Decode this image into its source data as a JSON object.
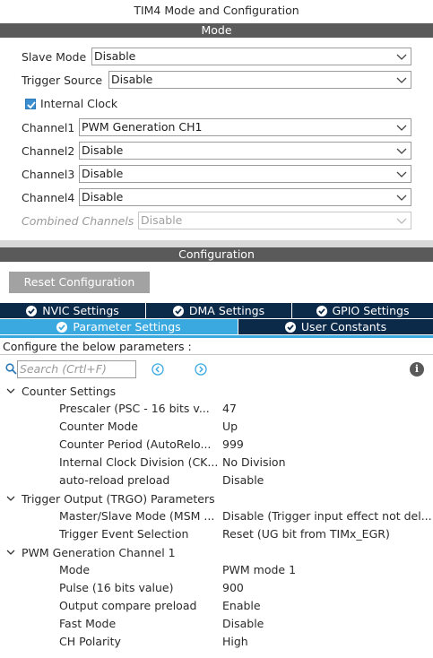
{
  "window_title": "TIM4 Mode and Configuration",
  "mode_section": {
    "title": "Mode",
    "slave_mode": {
      "label": "Slave Mode",
      "value": "Disable"
    },
    "trigger_source": {
      "label": "Trigger Source",
      "value": "Disable"
    },
    "internal_clock": {
      "label": "Internal Clock",
      "checked": true
    },
    "channel1": {
      "label": "Channel1",
      "value": "PWM Generation CH1"
    },
    "channel2": {
      "label": "Channel2",
      "value": "Disable"
    },
    "channel3": {
      "label": "Channel3",
      "value": "Disable"
    },
    "channel4": {
      "label": "Channel4",
      "value": "Disable"
    },
    "combined_channels": {
      "label": "Combined Channels",
      "value": "Disable",
      "enabled": false
    }
  },
  "configuration_section": {
    "title": "Configuration",
    "reset_button": "Reset Configuration",
    "tabs_row1": [
      "NVIC Settings",
      "DMA Settings",
      "GPIO Settings"
    ],
    "tabs_row2": [
      "Parameter Settings",
      "User Constants"
    ],
    "active_tab": "Parameter Settings",
    "description": "Configure the below parameters :",
    "search_placeholder": "Search (Crtl+F)",
    "groups": [
      {
        "name": "Counter Settings",
        "items": [
          {
            "label": "Prescaler (PSC - 16 bits v...",
            "value": "47"
          },
          {
            "label": "Counter Mode",
            "value": "Up"
          },
          {
            "label": "Counter Period (AutoRelo...",
            "value": "999"
          },
          {
            "label": "Internal Clock Division (CK...",
            "value": "No Division"
          },
          {
            "label": "auto-reload preload",
            "value": "Disable"
          }
        ]
      },
      {
        "name": "Trigger Output (TRGO) Parameters",
        "items": [
          {
            "label": "Master/Slave Mode (MSM ...",
            "value": "Disable (Trigger input effect not del..."
          },
          {
            "label": "Trigger Event Selection",
            "value": "Reset (UG bit from TIMx_EGR)"
          }
        ]
      },
      {
        "name": "PWM Generation Channel 1",
        "items": [
          {
            "label": "Mode",
            "value": "PWM mode 1"
          },
          {
            "label": "Pulse (16 bits value)",
            "value": "900"
          },
          {
            "label": "Output compare preload",
            "value": "Enable"
          },
          {
            "label": "Fast Mode",
            "value": "Disable"
          },
          {
            "label": "CH Polarity",
            "value": "High"
          }
        ]
      }
    ]
  },
  "colors": {
    "section_bar": "#5a5a5a",
    "tab_dark": "#0b2a4a",
    "tab_active": "#3aa9e0",
    "checkbox": "#3b8ed0",
    "reset_button": "#a2a2a2"
  },
  "icons": [
    "chevron-down-icon",
    "check-icon",
    "search-icon",
    "arrow-left-icon",
    "arrow-right-icon",
    "info-icon",
    "caret-down-icon"
  ]
}
